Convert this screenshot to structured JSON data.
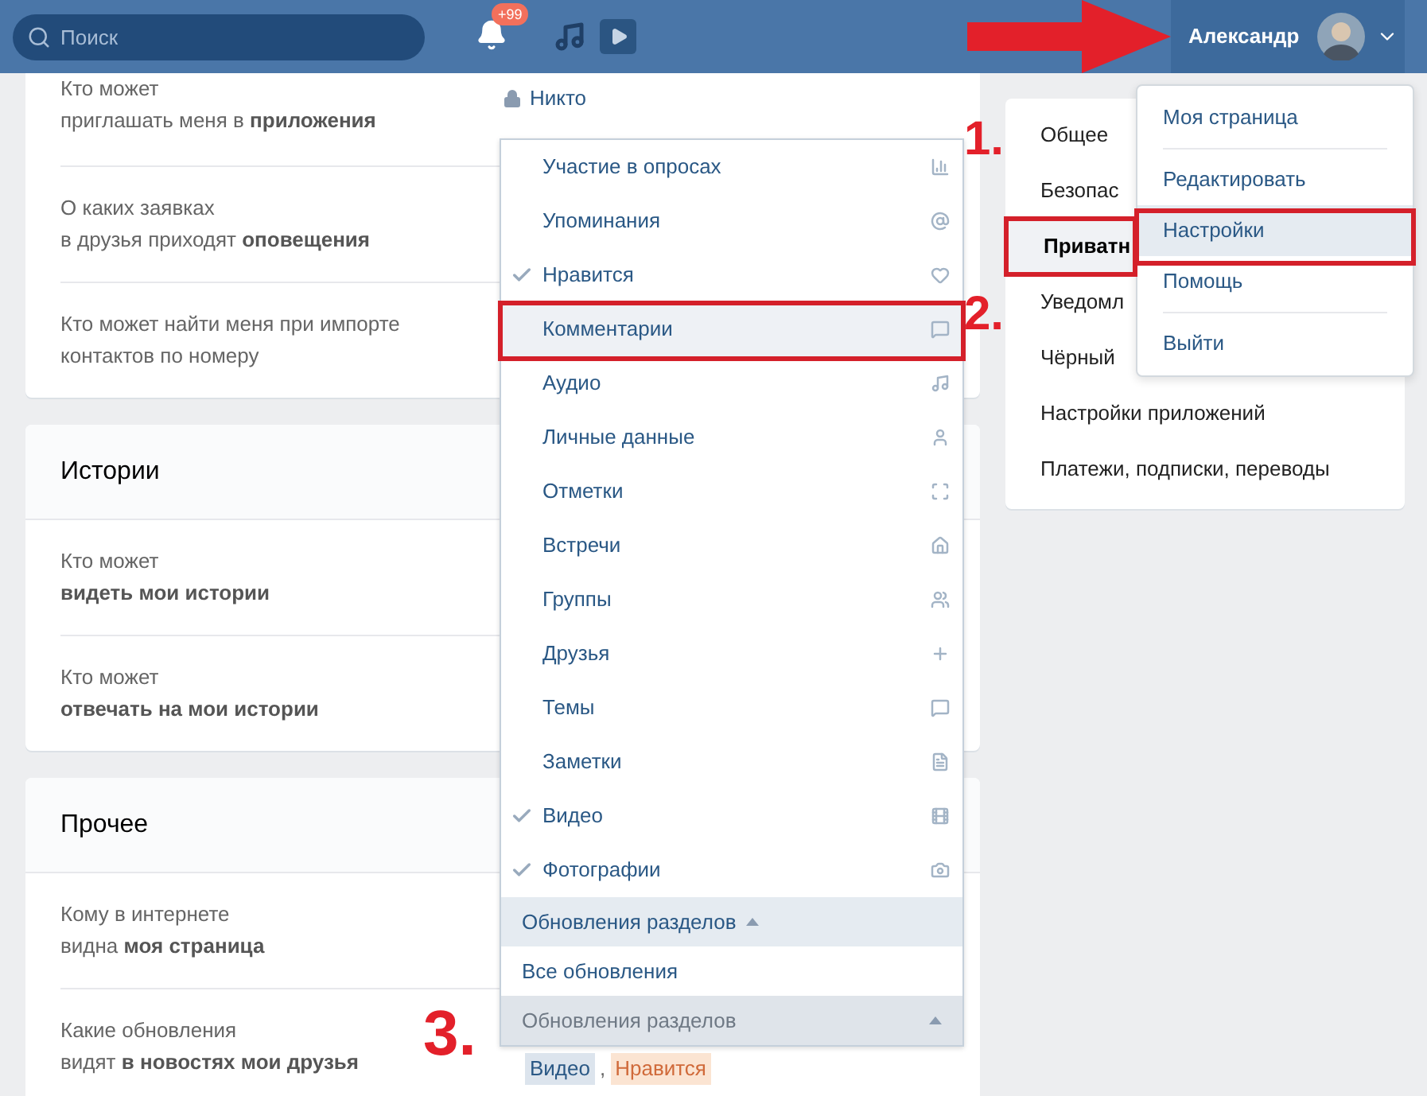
{
  "header": {
    "search": {
      "placeholder": "Поиск"
    },
    "notifications_badge": "+99",
    "user_name": "Александр"
  },
  "sections": [
    {
      "rows": [
        {
          "label": "Кто может\nприглашать меня в **приложения**",
          "value": "Никто"
        },
        {
          "label": "О каких заявках\nв друзья приходят **оповещения**"
        },
        {
          "label": "Кто может найти меня при импорте\nконтактов по номеру"
        }
      ]
    },
    {
      "title": "Истории",
      "rows": [
        {
          "label": "Кто может\n**видеть мои истории**"
        },
        {
          "label": "Кто может\n**отвечать на мои истории**"
        }
      ]
    },
    {
      "title": "Прочее",
      "rows": [
        {
          "label": "Кому в интернете\nвидна **моя страница**"
        },
        {
          "label": "Какие обновления\nвидят **в новостях мои друзья**",
          "tags": [
            {
              "label": "Видео",
              "color": "#dce4ed"
            },
            {
              "label": "Нравится",
              "color": "#fbe4d2"
            }
          ],
          "separator": ","
        }
      ]
    }
  ],
  "settings_menu": [
    {
      "label": "Общее",
      "selected": false
    },
    {
      "label": "Безопас",
      "selected": false
    },
    {
      "label": "Приватн",
      "selected": true
    },
    {
      "label": "Уведомл",
      "selected": false
    },
    {
      "label": "Чёрный",
      "selected": false
    },
    {
      "label": "Настройки приложений",
      "selected": false
    },
    {
      "label": "Платежи, подписки, переводы",
      "selected": false
    }
  ],
  "updates_dropdown": {
    "items": [
      {
        "label": "Участие в опросах",
        "checked": false,
        "selected": false
      },
      {
        "label": "Упоминания",
        "checked": false,
        "selected": false
      },
      {
        "label": "Нравится",
        "checked": true,
        "selected": false
      },
      {
        "label": "Комментарии",
        "checked": false,
        "selected": true
      },
      {
        "label": "Аудио",
        "checked": false,
        "selected": false
      },
      {
        "label": "Личные данные",
        "checked": false,
        "selected": false
      },
      {
        "label": "Отметки",
        "checked": false,
        "selected": false
      },
      {
        "label": "Встречи",
        "checked": false,
        "selected": false
      },
      {
        "label": "Группы",
        "checked": false,
        "selected": false
      },
      {
        "label": "Друзья",
        "checked": false,
        "selected": false
      },
      {
        "label": "Темы",
        "checked": false,
        "selected": false
      },
      {
        "label": "Заметки",
        "checked": false,
        "selected": false
      },
      {
        "label": "Видео",
        "checked": true,
        "selected": false
      },
      {
        "label": "Фотографии",
        "checked": true,
        "selected": false
      }
    ],
    "options": [
      {
        "label": "Обновления разделов",
        "selected": true
      },
      {
        "label": "Все обновления",
        "selected": false
      }
    ],
    "current": "Обновления разделов"
  },
  "profile_menu": [
    {
      "kind": "item",
      "label": "Моя страница",
      "selected": false
    },
    {
      "kind": "divider"
    },
    {
      "kind": "item",
      "label": "Редактировать",
      "selected": false
    },
    {
      "kind": "item",
      "label": "Настройки",
      "selected": true
    },
    {
      "kind": "item",
      "label": "Помощь",
      "selected": false
    },
    {
      "kind": "divider"
    },
    {
      "kind": "item",
      "label": "Выйти",
      "selected": false
    }
  ],
  "annotations": [
    {
      "label": "1."
    },
    {
      "label": "2."
    },
    {
      "label": "3."
    }
  ]
}
